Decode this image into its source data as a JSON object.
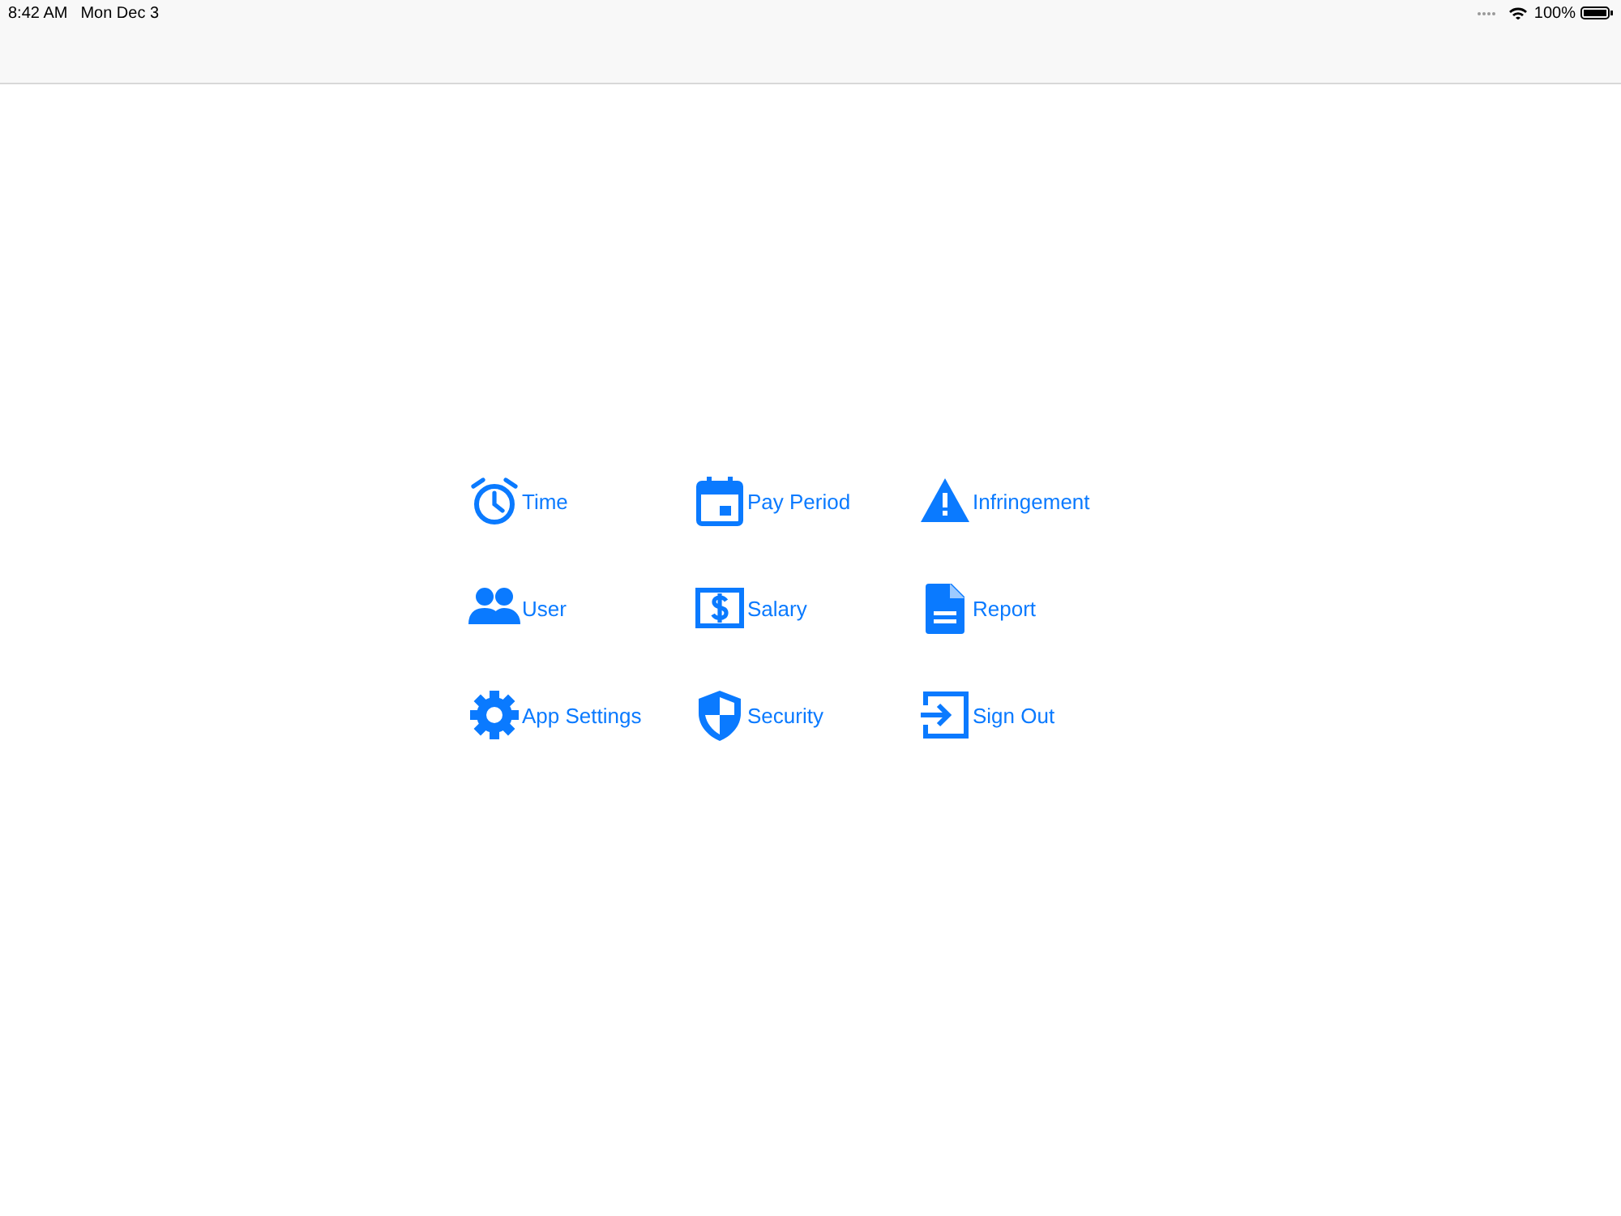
{
  "status_bar": {
    "time": "8:42 AM",
    "date": "Mon Dec 3",
    "battery": "100%"
  },
  "menu": [
    {
      "label": "Time"
    },
    {
      "label": "Pay Period"
    },
    {
      "label": "Infringement"
    },
    {
      "label": "User"
    },
    {
      "label": "Salary"
    },
    {
      "label": "Report"
    },
    {
      "label": "App Settings"
    },
    {
      "label": "Security"
    },
    {
      "label": "Sign Out"
    }
  ]
}
